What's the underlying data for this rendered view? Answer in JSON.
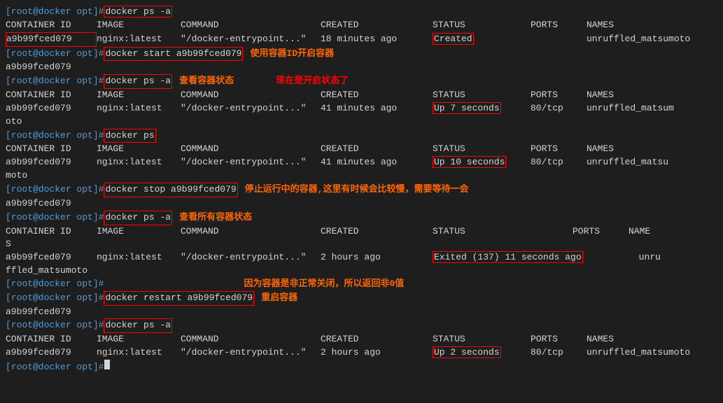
{
  "terminal": {
    "lines": [
      {
        "type": "prompt-cmd",
        "prompt": "[root@docker opt]#",
        "cmd": "docker ps -a",
        "highlight": true
      },
      {
        "type": "table-header",
        "cols": [
          "CONTAINER ID",
          "IMAGE",
          "COMMAND",
          "CREATED",
          "STATUS",
          "PORTS",
          "NAMES"
        ]
      },
      {
        "type": "table-row",
        "container": "a9b99fced079",
        "image": "nginx:latest",
        "command": "\"/docker-entrypoint...\"",
        "created": "18 minutes ago",
        "status": "Created",
        "status_box": true,
        "ports": "",
        "names": "unruffled_matsumoto"
      },
      {
        "type": "prompt-cmd",
        "prompt": "[root@docker opt]#",
        "cmd": "docker start a9b99fced079",
        "highlight": true,
        "comment": "使用容器ID开启容器"
      },
      {
        "type": "plain",
        "text": "a9b99fced079"
      },
      {
        "type": "prompt-cmd",
        "prompt": "[root@docker opt]#",
        "cmd": "docker ps -a",
        "highlight": true,
        "comment": "查看容器状态",
        "comment2": "现在是开启状态了",
        "comment2_color": "#ff0000"
      },
      {
        "type": "table-header",
        "cols": [
          "CONTAINER ID",
          "IMAGE",
          "COMMAND",
          "CREATED",
          "STATUS",
          "PORTS",
          "NAMES"
        ]
      },
      {
        "type": "table-row",
        "container": "a9b99fced079",
        "image": "nginx:latest",
        "command": "\"/docker-entrypoint...\"",
        "created": "41 minutes ago",
        "status": "Up 7 seconds",
        "status_box": true,
        "ports": "80/tcp",
        "names": "unruffled_matsum\noto"
      },
      {
        "type": "prompt-cmd",
        "prompt": "[root@docker opt]#",
        "cmd": "docker ps",
        "highlight": true
      },
      {
        "type": "table-header",
        "cols": [
          "CONTAINER ID",
          "IMAGE",
          "COMMAND",
          "CREATED",
          "STATUS",
          "PORTS",
          "NAMES"
        ]
      },
      {
        "type": "table-row",
        "container": "a9b99fced079",
        "image": "nginx:latest",
        "command": "\"/docker-entrypoint...\"",
        "created": "41 minutes ago",
        "status": "Up 10 seconds",
        "status_box": true,
        "ports": "80/tcp",
        "names": "unruffled_matsu\nmoto"
      },
      {
        "type": "prompt-cmd",
        "prompt": "[root@docker opt]#",
        "cmd": "docker stop a9b99fced079",
        "highlight": true,
        "comment": "停止运行中的容器,这里有时候会比较慢，需要等待一会"
      },
      {
        "type": "plain",
        "text": "a9b99fced079"
      },
      {
        "type": "prompt-cmd",
        "prompt": "[root@docker opt]#",
        "cmd": "docker ps -a",
        "highlight": true,
        "comment": "查看所有容器状态"
      },
      {
        "type": "table-header2",
        "cols": [
          "CONTAINER ID",
          "IMAGE",
          "COMMAND",
          "CREATED",
          "STATUS",
          "PORTS",
          "NAME\nS"
        ]
      },
      {
        "type": "table-row2",
        "container": "a9b99fced079",
        "image": "nginx:latest",
        "command": "\"/docker-entrypoint...\"",
        "created": "2 hours ago",
        "status": "Exited (137) 11 seconds ago",
        "status_box": true,
        "ports": "",
        "names": "unru\nffled_matsumoto"
      },
      {
        "type": "prompt-cmd",
        "prompt": "[root@docker opt]#"
      },
      {
        "type": "comment-only",
        "comment": "因为容器是非正常关闭，所以返回非0值"
      },
      {
        "type": "prompt-cmd",
        "prompt": "[root@docker opt]#",
        "cmd": "docker restart a9b99fced079",
        "highlight": true,
        "comment": "重启容器"
      },
      {
        "type": "plain",
        "text": "a9b99fced079"
      },
      {
        "type": "prompt-cmd",
        "prompt": "[root@docker opt]#",
        "cmd": "docker ps -a",
        "highlight": true
      },
      {
        "type": "table-header",
        "cols": [
          "CONTAINER ID",
          "IMAGE",
          "COMMAND",
          "CREATED",
          "STATUS",
          "PORTS",
          "NAMES"
        ]
      },
      {
        "type": "table-row",
        "container": "a9b99fced079",
        "image": "nginx:latest",
        "command": "\"/docker-entrypoint...\"",
        "created": "2 hours ago",
        "status": "Up 2 seconds",
        "status_box": true,
        "ports": "80/tcp",
        "names": "unruffled_matsumoto"
      },
      {
        "type": "prompt-cursor",
        "prompt": "[root@docker opt]#"
      }
    ]
  }
}
